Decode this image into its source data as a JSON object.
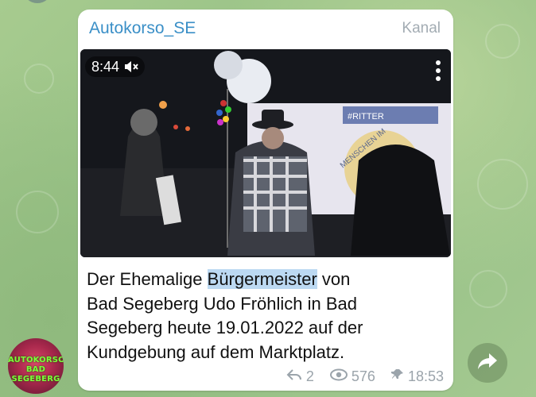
{
  "channel": {
    "name": "Autokorso_SE",
    "tag": "Kanal"
  },
  "video": {
    "duration": "8:44",
    "muted": true,
    "banner_text": "#RITTER",
    "banner_sub": "MENSCHEN IM"
  },
  "message": {
    "text_before": "Der Ehemalige ",
    "text_highlight": "Bürgermeister",
    "text_after": " von\nBad Segeberg Udo Fröhlich in Bad\nSegeberg heute 19.01.2022 auf der\nKundgebung auf dem Marktplatz."
  },
  "meta": {
    "replies": "2",
    "views": "576",
    "time": "18:53"
  },
  "avatar": {
    "line1": "AUTOKORSO",
    "line2": "BAD",
    "line3": "SEGEBERG"
  },
  "colors": {
    "accent": "#3a8fc7",
    "highlight": "#bcd9f2",
    "meta": "#9ba4ab"
  }
}
